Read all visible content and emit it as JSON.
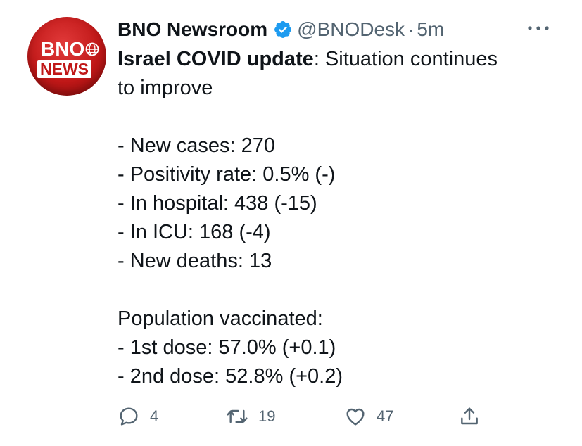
{
  "author": {
    "name": "BNO Newsroom",
    "handle": "@BNODesk",
    "separator": "·",
    "time": "5m",
    "verified_icon": "verified-badge-icon",
    "avatar_logo": {
      "top": "BNO",
      "bottom": "NEWS"
    },
    "brand_color": "#c01818",
    "verified_color": "#1d9bf0"
  },
  "tweet": {
    "title_bold": "Israel COVID update",
    "title_rest": ": Situation continues",
    "line2": "to improve",
    "stats": [
      "- New cases: 270",
      "- Positivity rate: 0.5% (-)",
      "- In hospital: 438 (-15)",
      "- In ICU: 168 (-4)",
      "- New deaths: 13"
    ],
    "vaccinated_heading": "Population vaccinated:",
    "vaccinated": [
      "- 1st dose: 57.0% (+0.1)",
      "- 2nd dose: 52.8% (+0.2)"
    ]
  },
  "actions": {
    "reply_count": "4",
    "retweet_count": "19",
    "like_count": "47",
    "icons": [
      "reply-icon",
      "retweet-icon",
      "like-icon",
      "share-icon"
    ]
  }
}
